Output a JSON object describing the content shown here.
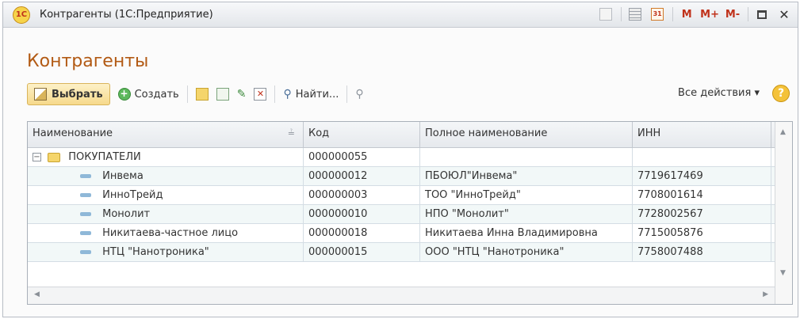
{
  "window": {
    "title": "Контрагенты (1С:Предприятие)",
    "logo_text": "1С",
    "buttons": [
      "М",
      "М+",
      "М-"
    ]
  },
  "page": {
    "heading": "Контрагенты"
  },
  "toolbar": {
    "select_label": "Выбрать",
    "create_label": "Создать",
    "find_label": "Найти...",
    "all_actions_label": "Все действия ▾",
    "help_label": "?"
  },
  "grid": {
    "columns": [
      "Наименование",
      "Код",
      "Полное наименование",
      "ИНН"
    ],
    "group": {
      "name": "ПОКУПАТЕЛИ",
      "code": "000000055"
    },
    "rows": [
      {
        "name": "Инвема",
        "code": "000000012",
        "full_name": "ПБОЮЛ\"Инвема\"",
        "inn": "7719617469"
      },
      {
        "name": "ИнноТрейд",
        "code": "000000003",
        "full_name": "ТОО \"ИнноТрейд\"",
        "inn": "7708001614"
      },
      {
        "name": "Монолит",
        "code": "000000010",
        "full_name": "НПО \"Монолит\"",
        "inn": "7728002567"
      },
      {
        "name": "Никитаева-частное лицо",
        "code": "000000018",
        "full_name": "Никитаева Инна Владимировна",
        "inn": "7715005876"
      },
      {
        "name": "НТЦ \"Нанотроника\"",
        "code": "000000015",
        "full_name": "ООО \"НТЦ \"Нанотроника\"",
        "inn": "7758007488"
      }
    ]
  },
  "colors": {
    "heading": "#b25a14",
    "accent": "#c0321b",
    "row_alt": "#f2f8f8"
  }
}
